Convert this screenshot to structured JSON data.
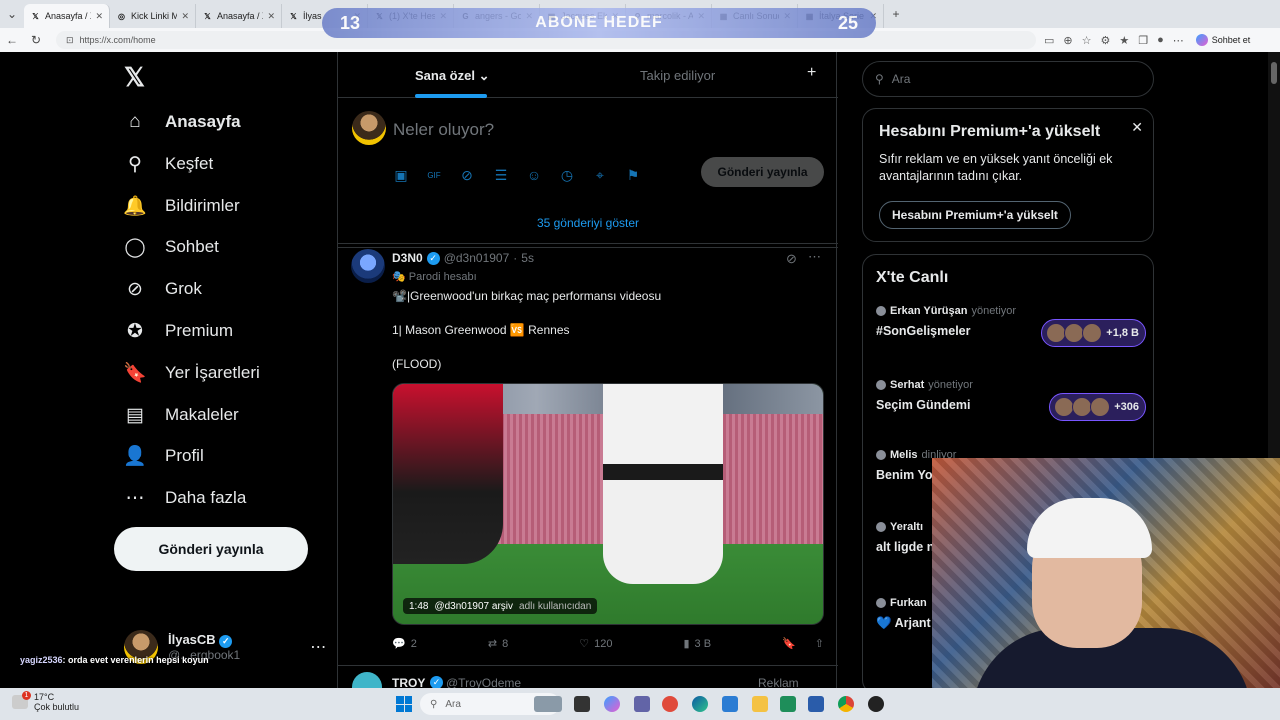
{
  "browser": {
    "tabs": [
      {
        "label": "Anasayfa / X",
        "icon": "x-logo-icon",
        "active": true
      },
      {
        "label": "Kick Linki Mo",
        "icon": "globe-icon",
        "active": false
      },
      {
        "label": "Anasayfa / X",
        "icon": "x-logo-icon",
        "active": false
      },
      {
        "label": "İlyas",
        "icon": "x-logo-icon",
        "active": false
      },
      {
        "label": "(1) X'te Hesa",
        "icon": "x-logo-icon",
        "active": false
      },
      {
        "label": "angers - Goo",
        "icon": "google-icon",
        "active": false
      },
      {
        "label": "Jacques Ekor",
        "icon": "news-icon",
        "active": false
      },
      {
        "label": "marcolik - A",
        "icon": "search-icon",
        "active": false
      },
      {
        "label": "Canlı Sonuç",
        "icon": "news-icon",
        "active": false
      },
      {
        "label": "İtalya Serie A",
        "icon": "news-icon",
        "active": false
      }
    ],
    "url": "https://x.com/home",
    "copilot_label": "Sohbet et"
  },
  "overlay": {
    "left": "13",
    "center": "ABONE HEDEF",
    "right": "25"
  },
  "x_app": {
    "nav": [
      {
        "label": "Anasayfa",
        "icon": "home-icon",
        "glyph": "⌂"
      },
      {
        "label": "Keşfet",
        "icon": "search-icon",
        "glyph": "⚲"
      },
      {
        "label": "Bildirimler",
        "icon": "bell-icon",
        "glyph": "🔔"
      },
      {
        "label": "Sohbet",
        "icon": "chat-icon",
        "glyph": "◯"
      },
      {
        "label": "Grok",
        "icon": "grok-icon",
        "glyph": "⊘"
      },
      {
        "label": "Premium",
        "icon": "premium-icon",
        "glyph": "✪"
      },
      {
        "label": "Yer İşaretleri",
        "icon": "bookmark-icon",
        "glyph": "🔖"
      },
      {
        "label": "Makaleler",
        "icon": "articles-icon",
        "glyph": "▤"
      },
      {
        "label": "Profil",
        "icon": "profile-icon",
        "glyph": "👤"
      },
      {
        "label": "Daha fazla",
        "icon": "more-icon",
        "glyph": "⋯"
      }
    ],
    "post_button": "Gönderi yayınla",
    "profile": {
      "name": "İlyasCB",
      "handle": "@...ergbook1"
    },
    "feed_tabs": {
      "for_you": "Sana özel",
      "following": "Takip ediliyor"
    },
    "composer": {
      "placeholder": "Neler oluyor?",
      "post_button": "Gönderi yayınla"
    },
    "show_posts": "35 gönderiyi göster",
    "tweet": {
      "name": "D3N0",
      "handle": "@d3n01907",
      "time": "5s",
      "parody": "Parodi hesabı",
      "line1": "📽️|Greenwood'un birkaç maç performansı videosu",
      "line2": "1| Mason Greenwood 🆚 Rennes",
      "line3": "(FLOOD)",
      "media_duration": "1:48",
      "media_user": "@d3n01907 arşiv",
      "media_suffix": "adlı kullanıcıdan",
      "stats": {
        "replies": "2",
        "reposts": "8",
        "likes": "120",
        "views": "3 B"
      }
    },
    "next_tweet": {
      "name": "TROY",
      "handle": "@TroyOdeme",
      "label": "Reklam"
    },
    "search_placeholder": "Ara",
    "premium_card": {
      "title": "Hesabını Premium+'a yükselt",
      "body": "Sıfır reklam ve en yüksek yanıt önceliği ek avantajlarının tadını çıkar.",
      "button": "Hesabını Premium+'a yükselt"
    },
    "live": {
      "title": "X'te Canlı",
      "items": [
        {
          "host": "Erkan Yürüşan",
          "role": "yönetiyor",
          "topic": "#SonGelişmeler",
          "count": "+1,8 B"
        },
        {
          "host": "Serhat",
          "role": "yönetiyor",
          "topic": "Seçim Gündemi",
          "count": "+306"
        },
        {
          "host": "Melis",
          "role": "dinliyor",
          "topic": "Benim Yo… Hiç Yolum",
          "count": ""
        },
        {
          "host": "Yeraltı",
          "role": "",
          "topic": "alt ligde n… de bilmiy",
          "count": ""
        },
        {
          "host": "Furkan",
          "role": "",
          "topic": "💙 Arjant… Şampiyor",
          "count": ""
        }
      ]
    }
  },
  "chat": {
    "user": "yagiz2536",
    "message": ": orda evet verenlerin hepsi koyun"
  },
  "taskbar": {
    "temp": "17°C",
    "weather": "Çok bulutlu",
    "search": "Ara",
    "notif": "1"
  }
}
